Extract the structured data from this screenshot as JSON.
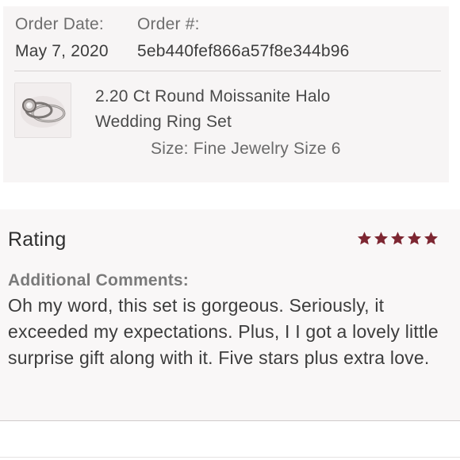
{
  "order": {
    "date_label": "Order Date:",
    "date_value": "May 7, 2020",
    "number_label": "Order #:",
    "number_value": "5eb440fef866a57f8e344b96"
  },
  "product": {
    "title_line1": "2.20 Ct Round Moissanite Halo",
    "title_line2": "Wedding Ring Set",
    "size": "Size: Fine Jewelry Size 6",
    "thumbnail_icon": "ring-set-photo"
  },
  "review": {
    "rating_label": "Rating",
    "rating_value": 5,
    "rating_max": 5,
    "star_color": "#7d2631",
    "comments_label": "Additional Comments:",
    "comments_text": "Oh my word, this set is gorgeous. Seriously, it exceeded my expectations. Plus, I I got a lovely little surprise gift along with it. Five stars plus extra love."
  }
}
